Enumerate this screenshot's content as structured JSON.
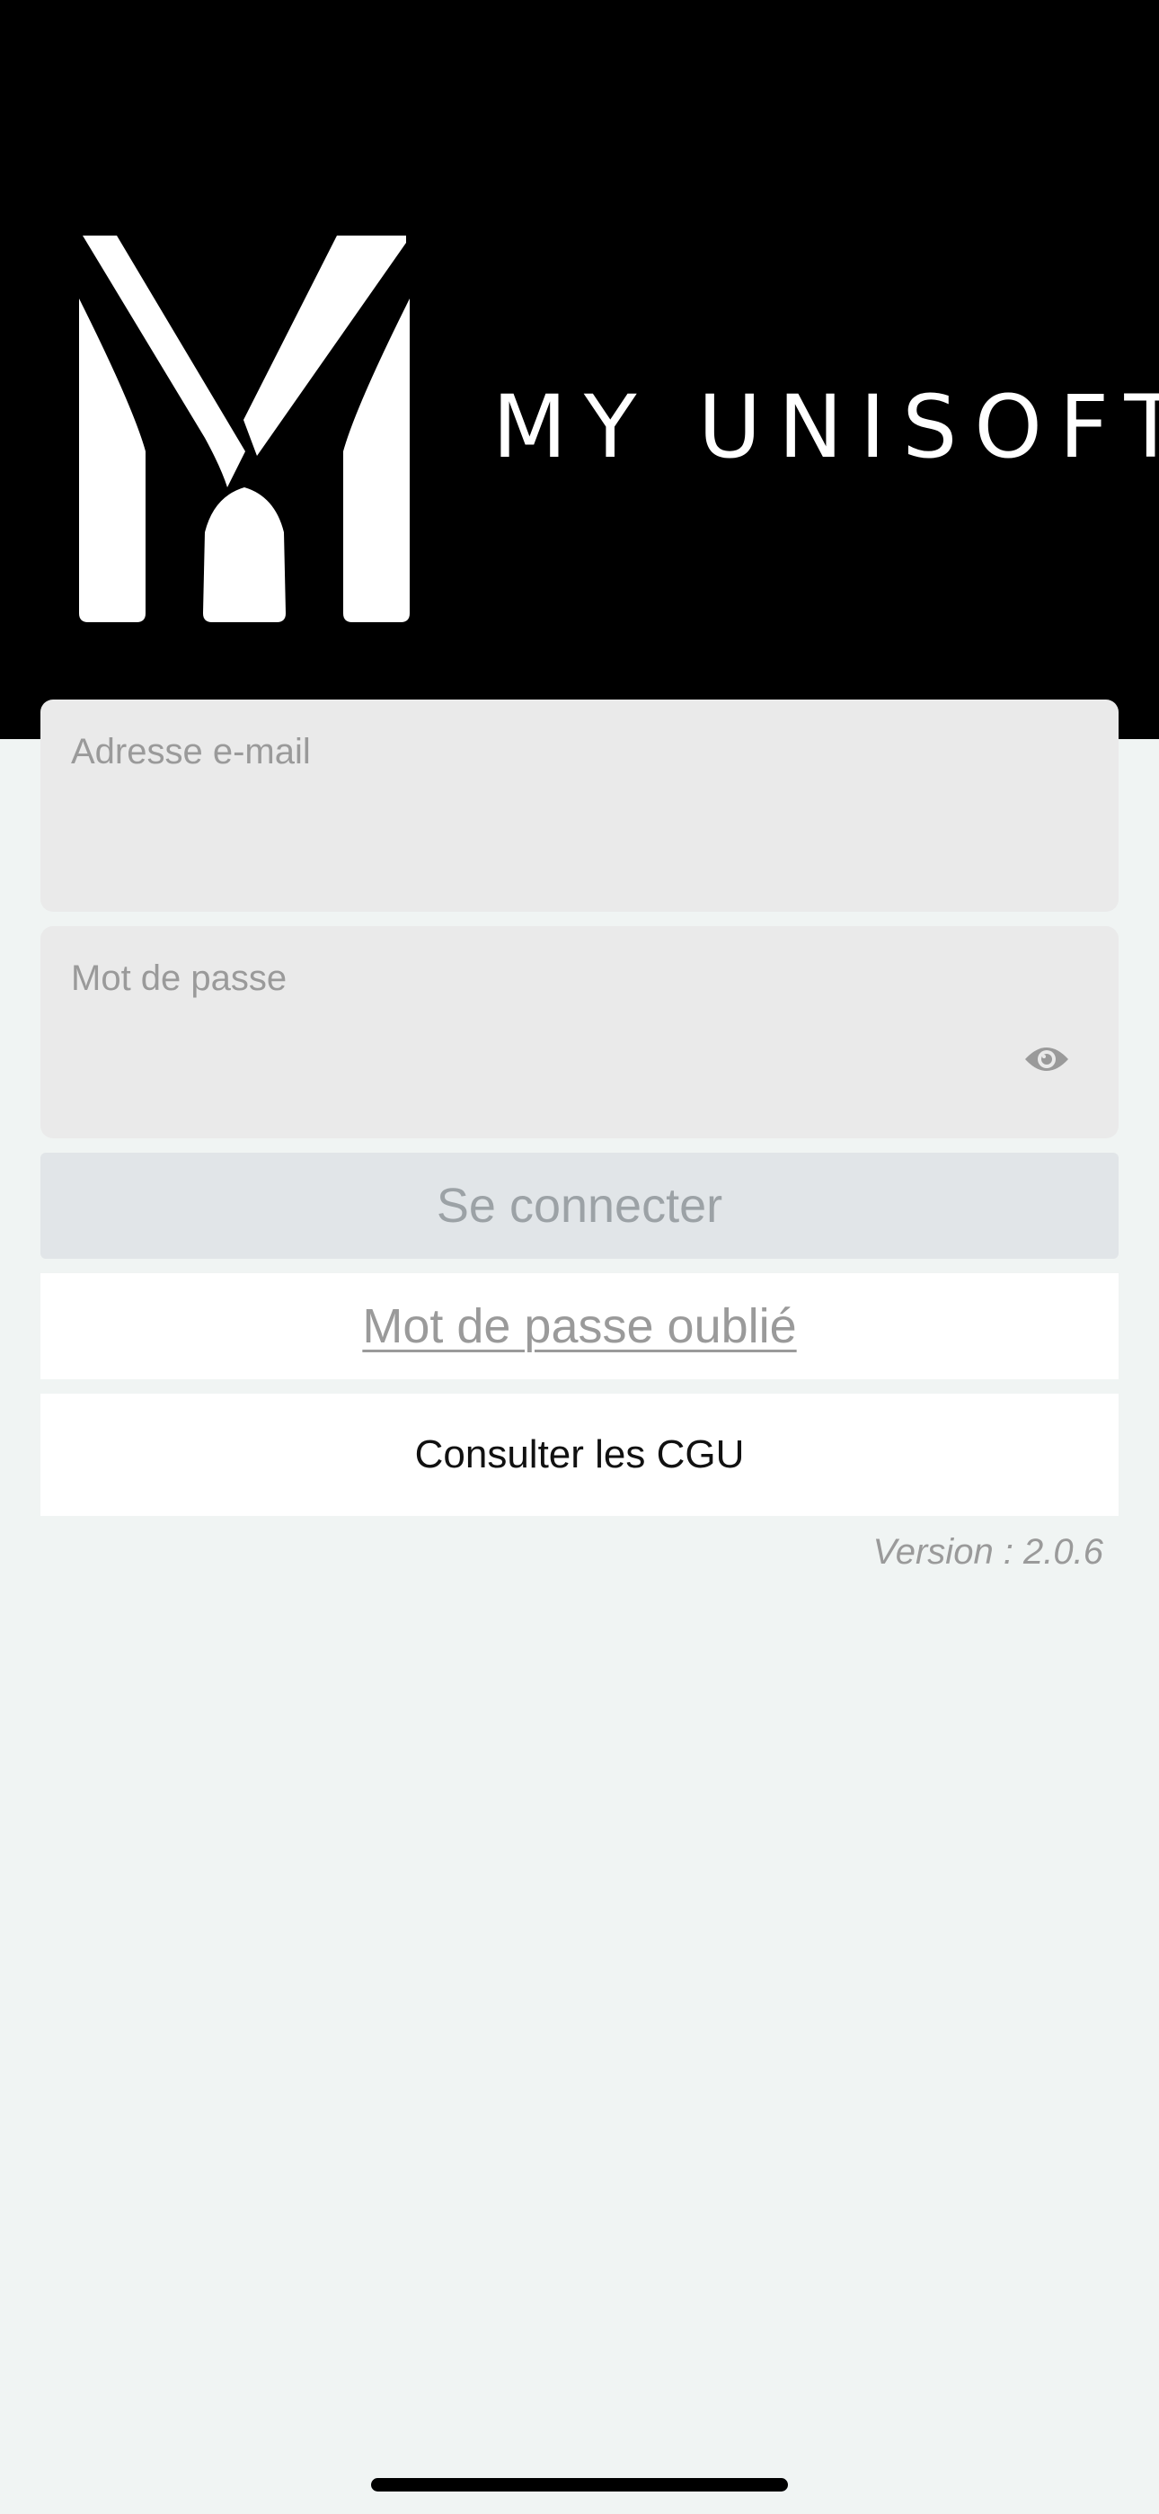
{
  "header": {
    "brand_name": "MY UNISOFT",
    "logo_icon": "my-unisoft-logo",
    "background": "#000000"
  },
  "login_form": {
    "email": {
      "label": "Adresse e-mail",
      "value": ""
    },
    "password": {
      "label": "Mot de passe",
      "value": "",
      "toggle_icon": "eye-icon"
    },
    "submit_label": "Se connecter",
    "forgot_password_label": "Mot de passe oublié",
    "terms_label": "Consulter les CGU"
  },
  "footer": {
    "version_text": "Version : 2.0.6"
  },
  "colors": {
    "page_background": "#f0f4f3",
    "field_background": "#eaeaea",
    "button_disabled_background": "#e1e5e8",
    "muted_text": "#9a9a9a"
  }
}
